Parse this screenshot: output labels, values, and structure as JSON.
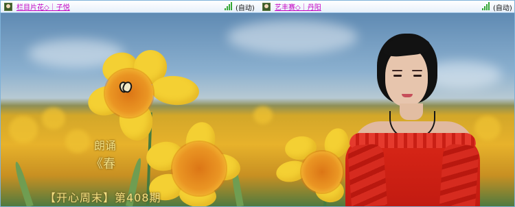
{
  "topbar": {
    "left_user": {
      "name": "栏目片花◇｜子悦",
      "status": "(自动)"
    },
    "right_user": {
      "name": "艺丰赛◇｜丹阳",
      "status": "(自动)"
    }
  },
  "video": {
    "overlay": {
      "label_1": "朗诵",
      "label_2": "《春",
      "caption": "【开心周末】第408期"
    }
  },
  "theme": {
    "accent": "#c200c2",
    "signal": "#34a834",
    "caption_color": "#f2df82",
    "dress_color": "#d92617"
  }
}
